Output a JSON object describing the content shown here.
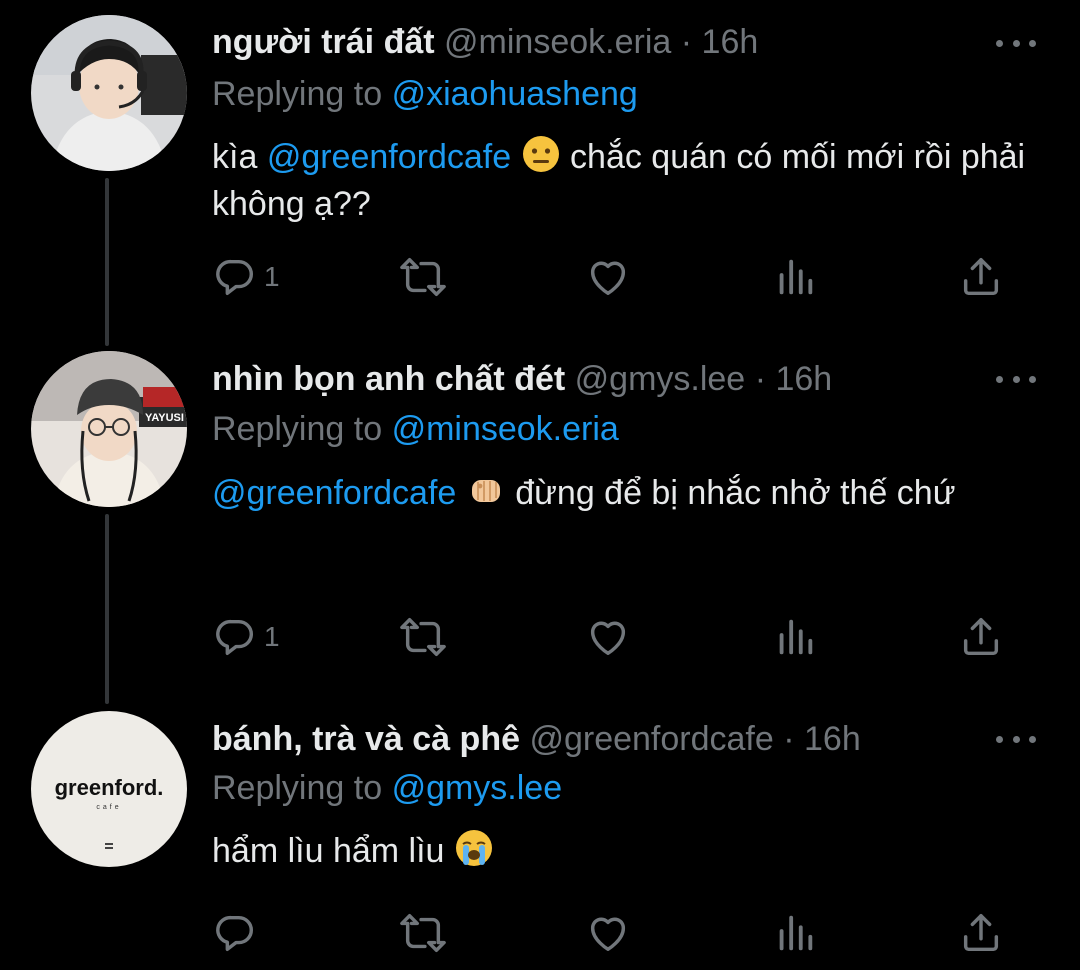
{
  "tweets": [
    {
      "display_name": "người trái đất",
      "handle": "@minseok.eria",
      "separator": "·",
      "time": "16h",
      "replying_prefix": "Replying to",
      "replying_to": "@xiaohuasheng",
      "body_mention": "@greenfordcafe",
      "body_before": "kìa",
      "body_after": "chắc quán có mối mới rồi phải không ạ??",
      "emoji": "neutral-face",
      "reply_count": "1"
    },
    {
      "display_name": "nhìn bọn anh chất đét",
      "handle": "@gmys.lee",
      "separator": "·",
      "time": "16h",
      "replying_prefix": "Replying to",
      "replying_to": "@minseok.eria",
      "body_mention": "@greenfordcafe",
      "body_after": "đừng để bị nhắc nhở thế chứ",
      "emoji": "oncoming-fist",
      "reply_count": "1",
      "avatar_text": "YAYUSI"
    },
    {
      "display_name": "bánh, trà và cà phê",
      "handle": "@greenfordcafe",
      "separator": "·",
      "time": "16h",
      "replying_prefix": "Replying to",
      "replying_to": "@gmys.lee",
      "body_text": "hẩm lìu hẩm lìu",
      "emoji": "loudly-crying-face",
      "reply_count": "",
      "avatar_logo": "greenford.",
      "avatar_sub": "cafe"
    }
  ],
  "colors": {
    "background": "#000000",
    "text": "#e7e9ea",
    "muted": "#71767b",
    "link": "#1d9bf0",
    "thread_line": "#333639"
  },
  "icons": [
    "reply-icon",
    "retweet-icon",
    "like-icon",
    "views-icon",
    "share-icon",
    "more-icon"
  ]
}
